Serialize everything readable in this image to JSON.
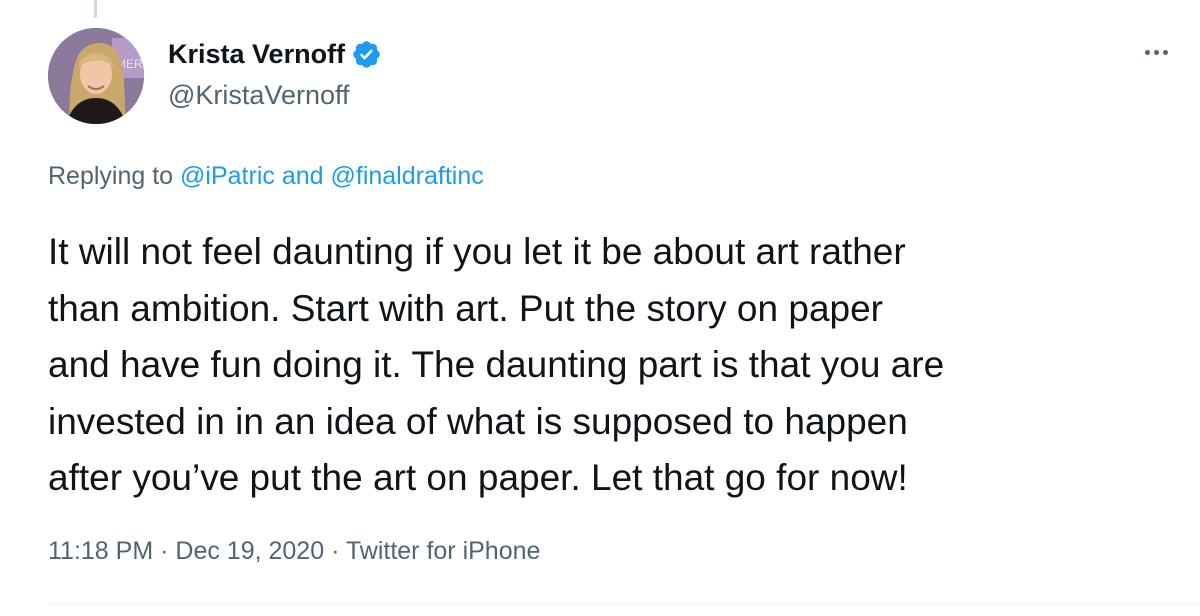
{
  "tweet": {
    "author": {
      "display_name": "Krista Vernoff",
      "handle": "@KristaVernoff",
      "verified": true,
      "avatar_icon": "user-avatar-photo",
      "avatar_text": "MER A"
    },
    "more_icon": "more-horizontal-icon",
    "reply": {
      "prefix": "Replying to",
      "mention_1": "@iPatric",
      "conjunction": "and",
      "mention_2": "@finaldraftinc"
    },
    "text_lines": [
      "It will not feel daunting if you let it be about art rather",
      "than ambition. Start with art. Put the story on paper",
      "and have fun doing it. The daunting part is that you are",
      "invested in in an idea of what is supposed to happen",
      "after you’ve put the art on paper. Let that go for now!"
    ],
    "meta": {
      "time": "11:18 PM",
      "separator": "·",
      "date": "Dec 19, 2020",
      "source": "Twitter for iPhone"
    }
  },
  "colors": {
    "text": "#0f1419",
    "secondary": "#536471",
    "link": "#1d9bf0",
    "verified_badge": "#1d9bf0"
  }
}
